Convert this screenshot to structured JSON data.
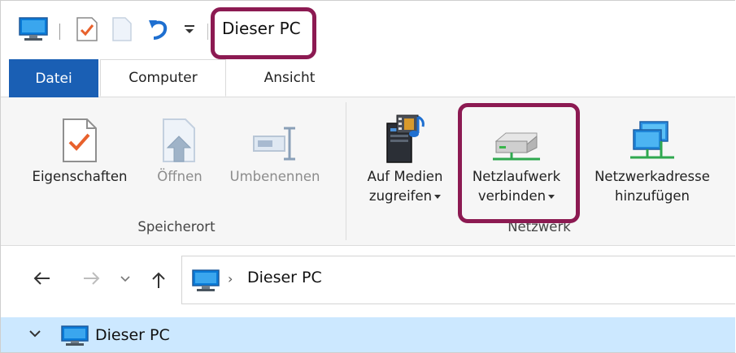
{
  "titlebar": {
    "title": "Dieser PC",
    "quick_access": [
      "computer-icon",
      "properties-icon",
      "page-icon",
      "undo-icon",
      "customize-dropdown-icon"
    ]
  },
  "tabs": [
    {
      "label": "Datei",
      "active": false
    },
    {
      "label": "Computer",
      "active": true
    },
    {
      "label": "Ansicht",
      "active": false
    }
  ],
  "ribbon": {
    "groups": {
      "speicherort": {
        "label": "Speicherort",
        "buttons": [
          {
            "label": "Eigenschaften",
            "icon": "properties-icon",
            "enabled": true
          },
          {
            "label": "Öffnen",
            "icon": "open-icon",
            "enabled": false
          },
          {
            "label": "Umbenennen",
            "icon": "rename-icon",
            "enabled": false
          }
        ]
      },
      "netzwerk": {
        "label": "Netzwerk",
        "buttons": [
          {
            "line1": "Auf Medien",
            "line2": "zugreifen",
            "icon": "media-access-icon",
            "dropdown": true
          },
          {
            "line1": "Netzlaufwerk",
            "line2": "verbinden",
            "icon": "network-drive-icon",
            "dropdown": true
          },
          {
            "line1": "Netzwerkadresse",
            "line2": "hinzufügen",
            "icon": "network-location-icon",
            "dropdown": false
          }
        ]
      }
    }
  },
  "navigation": {
    "address_path": "Dieser PC",
    "buttons": [
      "back-arrow-icon",
      "forward-arrow-icon",
      "recent-locations-icon",
      "up-arrow-icon"
    ]
  },
  "tree": {
    "selected_item": "Dieser PC",
    "expanded": true
  },
  "colors": {
    "accent": "#1a5fb4",
    "highlight": "#8c1a52",
    "selection": "#cce8ff"
  }
}
